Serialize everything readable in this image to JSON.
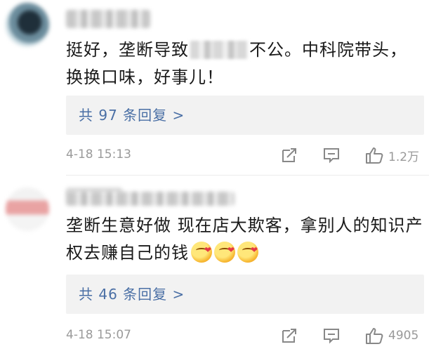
{
  "comments": [
    {
      "text_before": "挺好，垄断导致",
      "text_after": "不公。中科院带头，换换口味，好事儿！",
      "replies_label": "共 97 条回复 >",
      "time": "4-18 15:13",
      "likes": "1.2万"
    },
    {
      "text": "垄断生意好做 现在店大欺客，拿别人的知识产权去赚自己的钱",
      "emoji_count": 3,
      "replies_label": "共 46 条回复 >",
      "time": "4-18 15:07",
      "likes": "4905"
    }
  ],
  "icons": {
    "share": "share-icon",
    "reply": "comment-icon",
    "like": "thumbs-up-icon"
  }
}
